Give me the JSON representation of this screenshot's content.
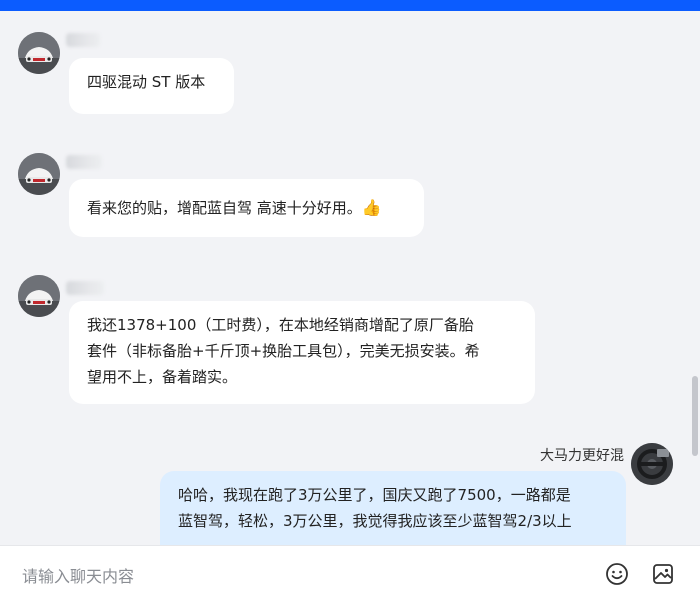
{
  "messages": [
    {
      "text": "四驱混动 ST 版本"
    },
    {
      "text": "看来您的贴，增配蓝自驾 高速十分好用。",
      "emoji": "👍"
    },
    {
      "text_lines": [
        "我还1378+100（工时费），在本地经销商增配了原厂备胎",
        "套件（非标备胎+千斤顶+换胎工具包），完美无损安装。希",
        "望用不上，备着踏实。"
      ]
    },
    {
      "username": "大马力更好混",
      "text_lines": [
        "哈哈，我现在跑了3万公里了，国庆又跑了7500，一路都是",
        "蓝智驾，轻松，3万公里，我觉得我应该至少蓝智驾2/3以上"
      ]
    }
  ],
  "input": {
    "placeholder": "请输入聊天内容",
    "value": ""
  },
  "icons": {
    "emoji_button": "smiley-icon",
    "image_button": "image-icon"
  },
  "colors": {
    "top_bar": "#0b5cff",
    "self_bubble": "#ddeeff",
    "other_bubble": "#ffffff",
    "background": "#f2f3f6"
  }
}
